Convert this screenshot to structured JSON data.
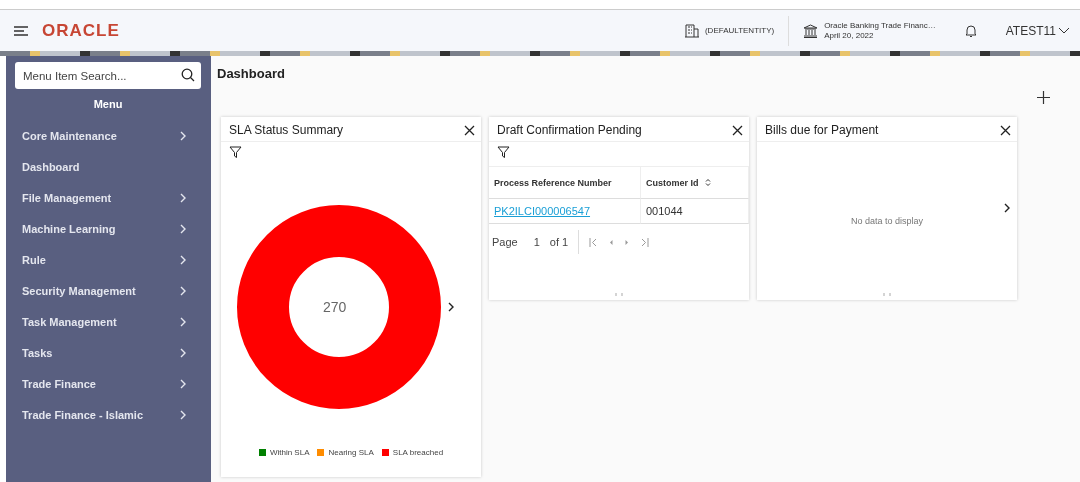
{
  "header": {
    "logo": "ORACLE",
    "entity": "(DEFAULTENTITY)",
    "bank_name": "Oracle Banking Trade Financ…",
    "date": "April 20, 2022",
    "user": "ATEST11"
  },
  "sidebar": {
    "search": {
      "placeholder": "Menu Item Search..."
    },
    "title": "Menu",
    "items": [
      {
        "label": "Core Maintenance",
        "has_children": true
      },
      {
        "label": "Dashboard",
        "has_children": false
      },
      {
        "label": "File Management",
        "has_children": true
      },
      {
        "label": "Machine Learning",
        "has_children": true
      },
      {
        "label": "Rule",
        "has_children": true
      },
      {
        "label": "Security Management",
        "has_children": true
      },
      {
        "label": "Task Management",
        "has_children": true
      },
      {
        "label": "Tasks",
        "has_children": true
      },
      {
        "label": "Trade Finance",
        "has_children": true
      },
      {
        "label": "Trade Finance - Islamic",
        "has_children": true
      }
    ]
  },
  "page_title": "Dashboard",
  "widgets": [
    {
      "kind": "donut",
      "title": "SLA Status Summary",
      "total": "270",
      "legend": [
        {
          "label": "Within SLA",
          "color": "#008000"
        },
        {
          "label": "Nearing SLA",
          "color": "#ff8c00"
        },
        {
          "label": "SLA breached",
          "color": "#ff0000"
        }
      ]
    },
    {
      "kind": "table",
      "title": "Draft Confirmation Pending",
      "columns": [
        "Process Reference Number",
        "Customer Id"
      ],
      "rows": [
        [
          "PK2ILCI000006547",
          "001044"
        ]
      ],
      "pager": {
        "label": "Page",
        "page": "1",
        "of": "of 1"
      }
    },
    {
      "kind": "empty",
      "title": "Bills due for Payment",
      "message": "No data to display"
    }
  ]
}
